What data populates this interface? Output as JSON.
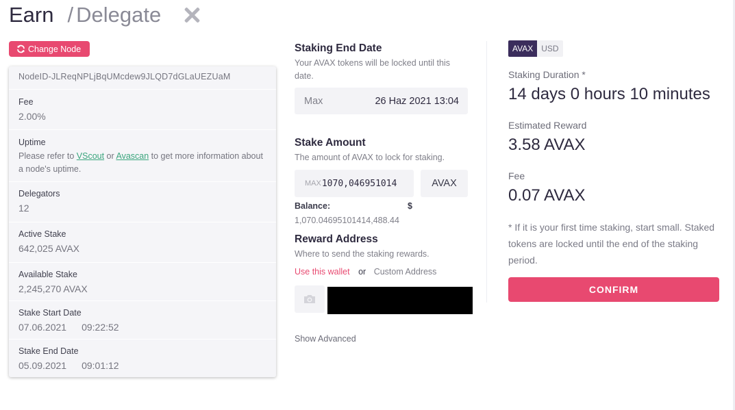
{
  "header": {
    "earn": "Earn",
    "separator": "/",
    "delegate": "Delegate"
  },
  "change_node": {
    "label": "Change Node"
  },
  "node": {
    "node_id": "NodeID-JLReqNPLjBqUMcdew9JLQD7dGLaUEZUaM",
    "fee": {
      "label": "Fee",
      "value": "2.00%"
    },
    "uptime": {
      "label": "Uptime",
      "help_prefix": "Please refer to ",
      "link1": "VScout",
      "or_text": " or ",
      "link2": "Avascan",
      "help_suffix": " to get more information about a node's uptime."
    },
    "delegators": {
      "label": "Delegators",
      "value": "12"
    },
    "active_stake": {
      "label": "Active Stake",
      "value": "642,025 AVAX"
    },
    "available_stake": {
      "label": "Available Stake",
      "value": "2,245,270 AVAX"
    },
    "stake_start": {
      "label": "Stake Start Date",
      "date": "07.06.2021",
      "time": "09:22:52"
    },
    "stake_end": {
      "label": "Stake End Date",
      "date": "05.09.2021",
      "time": "09:01:12"
    }
  },
  "staking_end": {
    "title": "Staking End Date",
    "desc": "Your AVAX tokens will be locked until this date.",
    "max_label": "Max",
    "date_value": "26 Haz 2021 13:04"
  },
  "stake_amount": {
    "title": "Stake Amount",
    "desc": "The amount of AVAX to lock for staking.",
    "max_label": "MAX",
    "amount": "1070,046951014",
    "currency": "AVAX",
    "balance_label": "Balance:",
    "balance_value": "1,070.04695101",
    "usd_symbol": "$",
    "usd_value": "414,488.44"
  },
  "reward": {
    "title": "Reward Address",
    "desc": "Where to send the staking rewards.",
    "option_wallet": "Use this wallet",
    "or": "or",
    "option_custom": "Custom Address"
  },
  "advanced": {
    "label": "Show Advanced"
  },
  "summary": {
    "currency_options": [
      "AVAX",
      "USD"
    ],
    "selected_currency": "AVAX",
    "duration_label": "Staking Duration *",
    "duration_value": "14 days 0 hours 10 minutes",
    "reward_label": "Estimated Reward",
    "reward_value": "3.58 AVAX",
    "fee_label": "Fee",
    "fee_value": "0.07 AVAX",
    "note": "* If it is your first time staking, start small. Staked tokens are locked until the end of the staking period.",
    "confirm_label": "CONFIRM"
  },
  "colors": {
    "accent": "#e84970",
    "link": "#3aa57d",
    "toggle_active": "#3b2d5c",
    "text_dark": "#2e2a3f",
    "redacted": "#000000"
  }
}
